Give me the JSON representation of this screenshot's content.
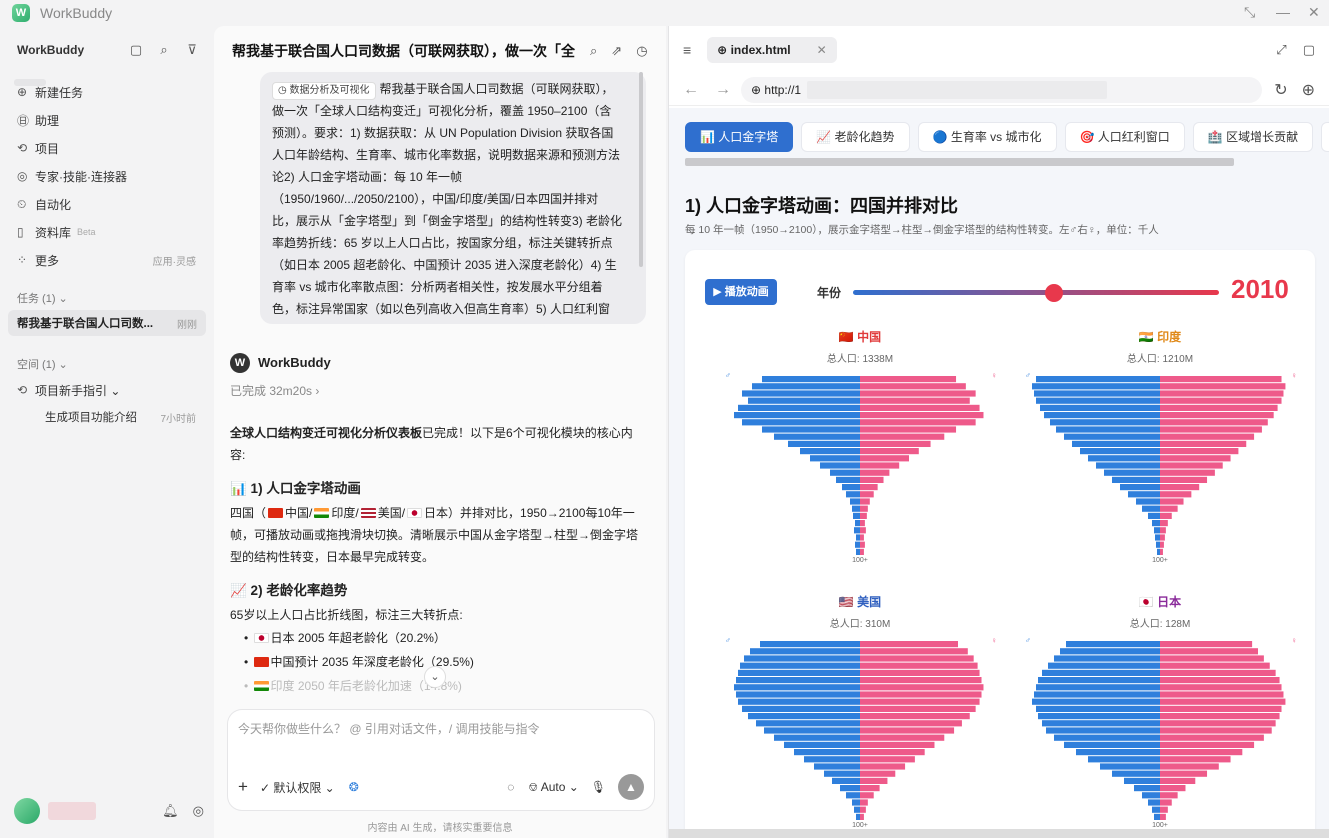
{
  "app": {
    "title": "WorkBuddy"
  },
  "sidebar": {
    "workspace": "WorkBuddy",
    "nav": [
      {
        "icon": "plus-circle-icon",
        "glyph": "⊕",
        "label": "新建任务",
        "extra": ""
      },
      {
        "icon": "assistant-icon",
        "glyph": "㊐",
        "label": "助理",
        "extra": ""
      },
      {
        "icon": "project-icon",
        "glyph": "⟲",
        "label": "项目",
        "extra": ""
      },
      {
        "icon": "expert-icon",
        "glyph": "◎",
        "label": "专家·技能·连接器",
        "extra": ""
      },
      {
        "icon": "automation-icon",
        "glyph": "⏲",
        "label": "自动化",
        "extra": ""
      },
      {
        "icon": "library-icon",
        "glyph": "▯",
        "label": "资料库",
        "extra": "",
        "beta": "Beta"
      },
      {
        "icon": "more-icon",
        "glyph": "⁘",
        "label": "更多",
        "extra": "应用·灵感"
      }
    ],
    "tasks_section": "任务 (1) ⌄",
    "task": {
      "label": "帮我基于联合国人口司数...",
      "time": "刚刚"
    },
    "spaces_section": "空间 (1) ⌄",
    "space_item": "项目新手指引 ⌄",
    "space_sub": {
      "label": "生成项目功能介绍",
      "time": "7小时前"
    }
  },
  "chat": {
    "title": "帮我基于联合国人口司数据（可联网获取），做一次「全",
    "user_tag": "◷ 数据分析及可视化",
    "user_text": "帮我基于联合国人口司数据（可联网获取），做一次「全球人口结构变迁」可视化分析，覆盖 1950–2100（含预测）。要求：1) 数据获取：从 UN Population Division 获取各国人口年龄结构、生育率、城市化率数据，说明数据来源和预测方法论2) 人口金字塔动画：每 10 年一帧（1950/1960/.../2050/2100），中国/印度/美国/日本四国并排对比，展示从「金字塔型」到「倒金字塔型」的结构性转变3) 老龄化率趋势折线：65 岁以上人口占比，按国家分组，标注关键转折点（如日本 2005 超老龄化、中国预计 2035 进入深度老龄化）4) 生育率 vs 城市化率散点图：分析两者相关性，按发展水平分组着色，标注异常国家（如以色列高收入但高生育率）5) 人口红利窗",
    "bot_name": "WorkBuddy",
    "done": "已完成 32m20s ›",
    "intro_bold": "全球人口结构变迁可视化分析仪表板",
    "intro_rest": "已完成！以下是6个可视化模块的核心内容:",
    "s1_title": "📊 1) 人口金字塔动画",
    "s1_a": "四国（",
    "s1_cn": "中国/",
    "s1_in": "印度/",
    "s1_us": "美国/",
    "s1_jp": "日本）并排对比，1950→2100每10年一帧，可播放动画或拖拽滑块切换。清晰展示中国从金字塔型→柱型→倒金字塔型的结构性转变，日本最早完成转变。",
    "s2_title": "📈 2) 老龄化率趋势",
    "s2_text": "65岁以上人口占比折线图，标注三大转折点:",
    "b1": "日本 2005 年超老龄化（20.2%）",
    "b2": "中国预计 2035 年深度老龄化（29.5%)",
    "b3": "印度 2050 年后老龄化加速（14.8%)",
    "input_placeholder": "今天帮你做些什么？ @ 引用对话文件，/ 调用技能与指令",
    "perm": "默认权限 ⌄",
    "model": "Auto ⌄",
    "disclaimer": "内容由 AI 生成，请核实重要信息"
  },
  "browser": {
    "tab": "index.html",
    "url": "http://1",
    "tabs": [
      "📊 人口金字塔",
      "📈 老龄化趋势",
      "🔵 生育率 vs 城市化",
      "🎯 人口红利窗口",
      "🏥 区域增长贡献",
      "📊"
    ],
    "page_title": "1) 人口金字塔动画：四国并排对比",
    "page_desc": "每 10 年一帧（1950→2100），展示金字塔型→柱型→倒金字塔型的结构性转变。左♂右♀，单位：千人",
    "play": "▶ 播放动画",
    "year_label": "年份",
    "year": "2010",
    "slider_fraction": 0.55,
    "pyramids": [
      {
        "name": "🇨🇳 中国",
        "total": "总人口: 1338M",
        "color": "#e03a3a",
        "shape": "cn"
      },
      {
        "name": "🇮🇳 印度",
        "total": "总人口: 1210M",
        "color": "#e08a1a",
        "shape": "in"
      },
      {
        "name": "🇺🇸 美国",
        "total": "总人口: 310M",
        "color": "#2f5fbf",
        "shape": "us"
      },
      {
        "name": "🇯🇵 日本",
        "total": "总人口: 128M",
        "color": "#8a2a9a",
        "shape": "jp"
      }
    ],
    "top_label": "100+"
  },
  "colors": {
    "male": "#2f7fdc",
    "female": "#ee5a8a",
    "accent": "#2f6fcf",
    "year": "#e8384c"
  }
}
